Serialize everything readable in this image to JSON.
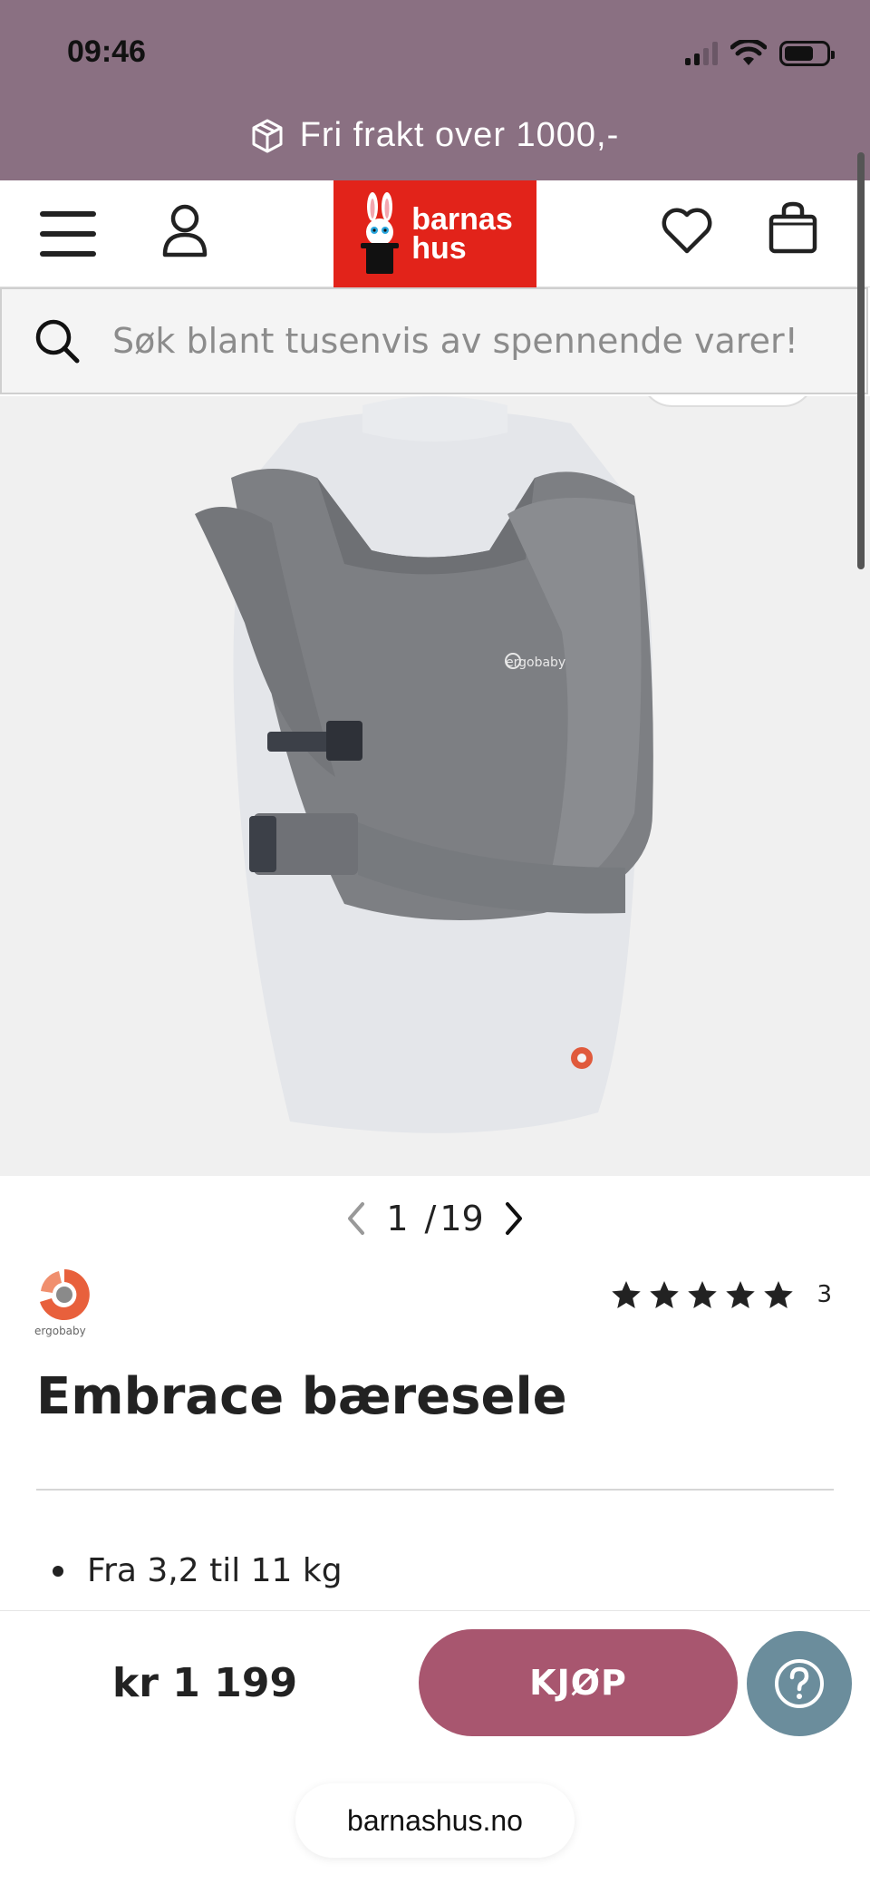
{
  "status_bar": {
    "time": "09:46"
  },
  "promo": {
    "text": "Fri frakt over 1000,-",
    "icon": "box-icon"
  },
  "header": {
    "logo": {
      "line1": "barnas",
      "line2": "hus"
    },
    "icons": [
      "menu-icon",
      "account-icon",
      "heart-icon",
      "bag-icon"
    ]
  },
  "search": {
    "placeholder": "Søk blant tusenvis av spennende varer!"
  },
  "gallery": {
    "current": "1",
    "separator": "/",
    "total": "19"
  },
  "product": {
    "brand": "ergobaby",
    "rating": {
      "stars": 5,
      "count": "3"
    },
    "title": "Embrace bæresele",
    "bullets": [
      "Fra 3,2 til 11 kg"
    ]
  },
  "purchase": {
    "price": "kr 1 199",
    "buy_label": "KJØP"
  },
  "browser": {
    "url": "barnashus.no"
  },
  "colors": {
    "topband": "#8a7082",
    "logo_red": "#e2231a",
    "buy": "#a8566f",
    "help": "#6b8d9c"
  }
}
